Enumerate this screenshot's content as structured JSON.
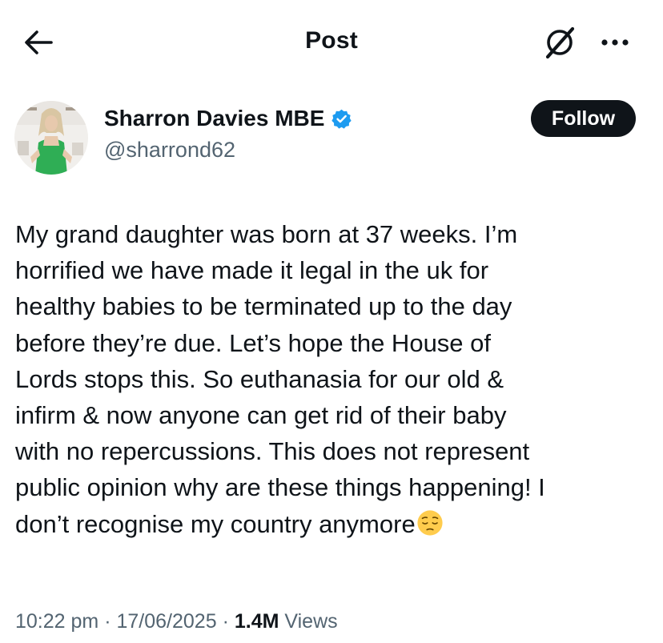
{
  "header": {
    "title": "Post",
    "back_icon": "arrow-left-icon",
    "grok_icon": "grok-icon",
    "more_icon": "more-horizontal-icon"
  },
  "author": {
    "display_name": "Sharron Davies MBE",
    "handle": "@sharrond62",
    "verified": true,
    "verified_color": "#1d9bf0",
    "avatar_icon": "avatar-photo"
  },
  "follow_button": {
    "label": "Follow"
  },
  "tweet": {
    "lines": [
      "My grand daughter was born at 37 weeks. I’m",
      "horrified we have made it legal in the uk for",
      "healthy babies to be terminated up to the day",
      "before they’re due. Let’s hope the House of",
      "Lords stops this. So euthanasia for our old &",
      "infirm & now anyone can get rid of their baby",
      "with no repercussions. This does not represent",
      "public opinion why are these things happening! I",
      "don’t recognise my country anymore"
    ],
    "emoji": "pensive-face-emoji"
  },
  "meta": {
    "time": "10:22 pm",
    "separator": "·",
    "date": "17/06/2025",
    "views_count": "1.4M",
    "views_label": "Views"
  },
  "colors": {
    "text_primary": "#0f1419",
    "text_secondary": "#536471",
    "follow_bg": "#0f1419",
    "follow_text": "#ffffff"
  }
}
